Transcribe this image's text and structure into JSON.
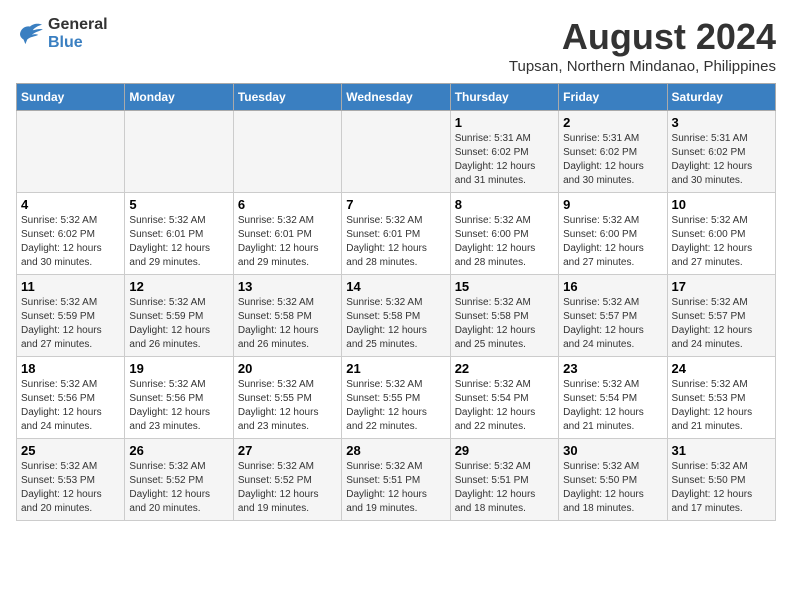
{
  "header": {
    "logo_line1": "General",
    "logo_line2": "Blue",
    "main_title": "August 2024",
    "subtitle": "Tupsan, Northern Mindanao, Philippines"
  },
  "days_of_week": [
    "Sunday",
    "Monday",
    "Tuesday",
    "Wednesday",
    "Thursday",
    "Friday",
    "Saturday"
  ],
  "weeks": [
    [
      {
        "day": "",
        "info": ""
      },
      {
        "day": "",
        "info": ""
      },
      {
        "day": "",
        "info": ""
      },
      {
        "day": "",
        "info": ""
      },
      {
        "day": "1",
        "info": "Sunrise: 5:31 AM\nSunset: 6:02 PM\nDaylight: 12 hours\nand 31 minutes."
      },
      {
        "day": "2",
        "info": "Sunrise: 5:31 AM\nSunset: 6:02 PM\nDaylight: 12 hours\nand 30 minutes."
      },
      {
        "day": "3",
        "info": "Sunrise: 5:31 AM\nSunset: 6:02 PM\nDaylight: 12 hours\nand 30 minutes."
      }
    ],
    [
      {
        "day": "4",
        "info": "Sunrise: 5:32 AM\nSunset: 6:02 PM\nDaylight: 12 hours\nand 30 minutes."
      },
      {
        "day": "5",
        "info": "Sunrise: 5:32 AM\nSunset: 6:01 PM\nDaylight: 12 hours\nand 29 minutes."
      },
      {
        "day": "6",
        "info": "Sunrise: 5:32 AM\nSunset: 6:01 PM\nDaylight: 12 hours\nand 29 minutes."
      },
      {
        "day": "7",
        "info": "Sunrise: 5:32 AM\nSunset: 6:01 PM\nDaylight: 12 hours\nand 28 minutes."
      },
      {
        "day": "8",
        "info": "Sunrise: 5:32 AM\nSunset: 6:00 PM\nDaylight: 12 hours\nand 28 minutes."
      },
      {
        "day": "9",
        "info": "Sunrise: 5:32 AM\nSunset: 6:00 PM\nDaylight: 12 hours\nand 27 minutes."
      },
      {
        "day": "10",
        "info": "Sunrise: 5:32 AM\nSunset: 6:00 PM\nDaylight: 12 hours\nand 27 minutes."
      }
    ],
    [
      {
        "day": "11",
        "info": "Sunrise: 5:32 AM\nSunset: 5:59 PM\nDaylight: 12 hours\nand 27 minutes."
      },
      {
        "day": "12",
        "info": "Sunrise: 5:32 AM\nSunset: 5:59 PM\nDaylight: 12 hours\nand 26 minutes."
      },
      {
        "day": "13",
        "info": "Sunrise: 5:32 AM\nSunset: 5:58 PM\nDaylight: 12 hours\nand 26 minutes."
      },
      {
        "day": "14",
        "info": "Sunrise: 5:32 AM\nSunset: 5:58 PM\nDaylight: 12 hours\nand 25 minutes."
      },
      {
        "day": "15",
        "info": "Sunrise: 5:32 AM\nSunset: 5:58 PM\nDaylight: 12 hours\nand 25 minutes."
      },
      {
        "day": "16",
        "info": "Sunrise: 5:32 AM\nSunset: 5:57 PM\nDaylight: 12 hours\nand 24 minutes."
      },
      {
        "day": "17",
        "info": "Sunrise: 5:32 AM\nSunset: 5:57 PM\nDaylight: 12 hours\nand 24 minutes."
      }
    ],
    [
      {
        "day": "18",
        "info": "Sunrise: 5:32 AM\nSunset: 5:56 PM\nDaylight: 12 hours\nand 24 minutes."
      },
      {
        "day": "19",
        "info": "Sunrise: 5:32 AM\nSunset: 5:56 PM\nDaylight: 12 hours\nand 23 minutes."
      },
      {
        "day": "20",
        "info": "Sunrise: 5:32 AM\nSunset: 5:55 PM\nDaylight: 12 hours\nand 23 minutes."
      },
      {
        "day": "21",
        "info": "Sunrise: 5:32 AM\nSunset: 5:55 PM\nDaylight: 12 hours\nand 22 minutes."
      },
      {
        "day": "22",
        "info": "Sunrise: 5:32 AM\nSunset: 5:54 PM\nDaylight: 12 hours\nand 22 minutes."
      },
      {
        "day": "23",
        "info": "Sunrise: 5:32 AM\nSunset: 5:54 PM\nDaylight: 12 hours\nand 21 minutes."
      },
      {
        "day": "24",
        "info": "Sunrise: 5:32 AM\nSunset: 5:53 PM\nDaylight: 12 hours\nand 21 minutes."
      }
    ],
    [
      {
        "day": "25",
        "info": "Sunrise: 5:32 AM\nSunset: 5:53 PM\nDaylight: 12 hours\nand 20 minutes."
      },
      {
        "day": "26",
        "info": "Sunrise: 5:32 AM\nSunset: 5:52 PM\nDaylight: 12 hours\nand 20 minutes."
      },
      {
        "day": "27",
        "info": "Sunrise: 5:32 AM\nSunset: 5:52 PM\nDaylight: 12 hours\nand 19 minutes."
      },
      {
        "day": "28",
        "info": "Sunrise: 5:32 AM\nSunset: 5:51 PM\nDaylight: 12 hours\nand 19 minutes."
      },
      {
        "day": "29",
        "info": "Sunrise: 5:32 AM\nSunset: 5:51 PM\nDaylight: 12 hours\nand 18 minutes."
      },
      {
        "day": "30",
        "info": "Sunrise: 5:32 AM\nSunset: 5:50 PM\nDaylight: 12 hours\nand 18 minutes."
      },
      {
        "day": "31",
        "info": "Sunrise: 5:32 AM\nSunset: 5:50 PM\nDaylight: 12 hours\nand 17 minutes."
      }
    ]
  ]
}
